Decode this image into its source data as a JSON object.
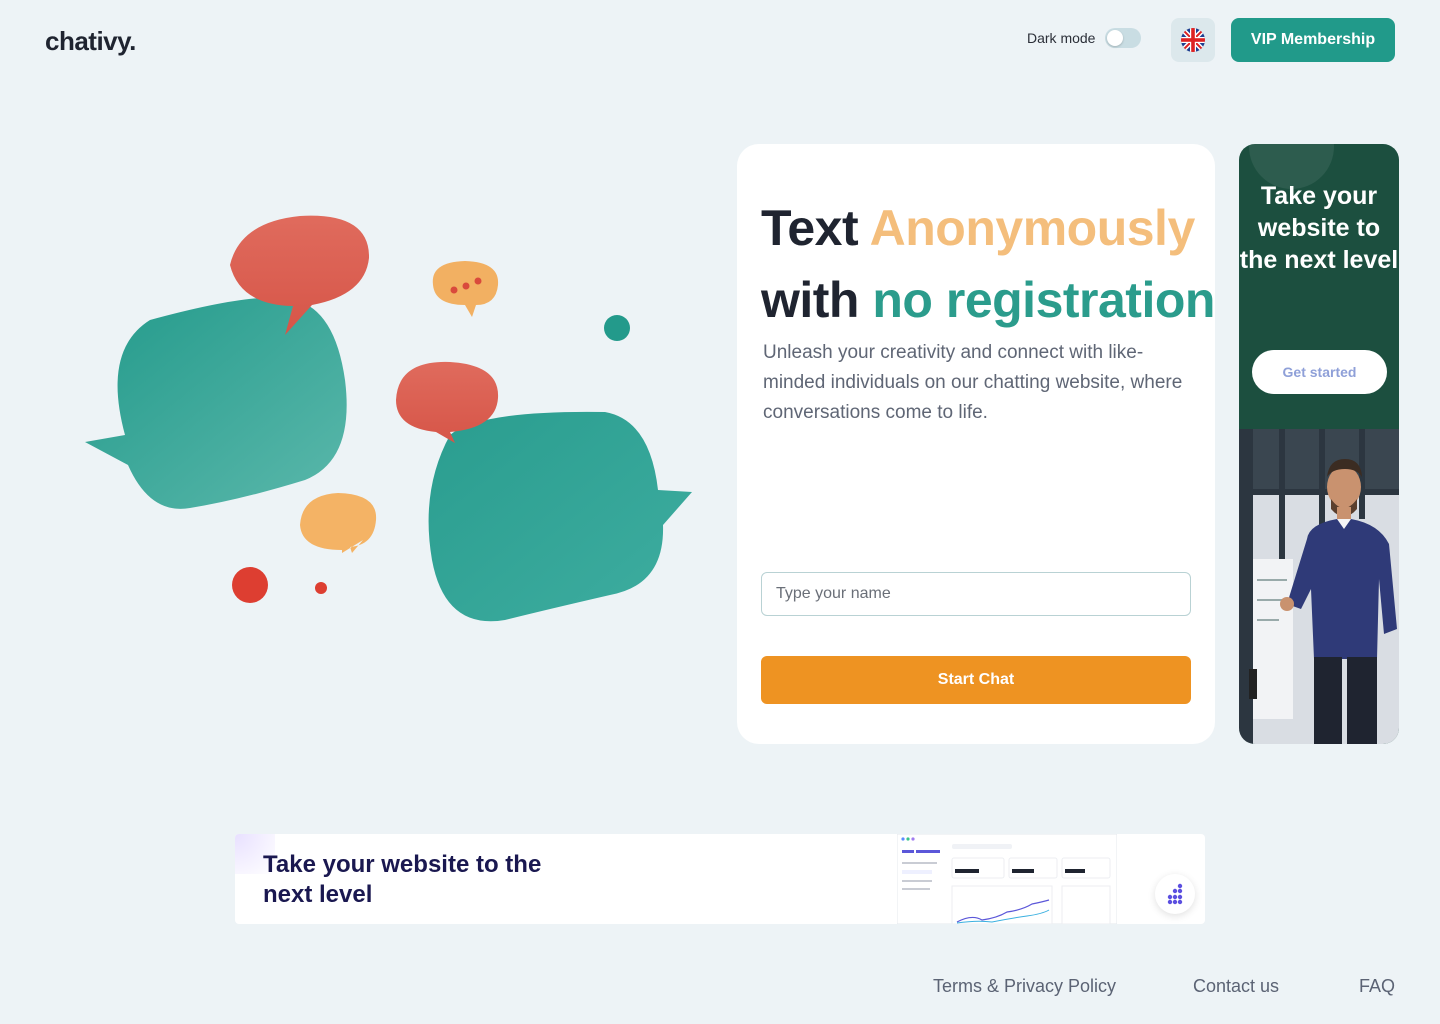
{
  "header": {
    "logo": "chativy.",
    "dark_mode_label": "Dark mode",
    "dark_mode_on": false,
    "language_icon": "uk-flag-icon",
    "vip_label": "VIP Membership"
  },
  "hero": {
    "headline_word1": "Text",
    "headline_word2": "Anonymously",
    "headline_word3": "with",
    "headline_word4": "no registration",
    "subtext": "Unleash your creativity and connect with like-minded individuals on our chatting website, where conversations come to life.",
    "name_placeholder": "Type your name",
    "start_label": "Start Chat"
  },
  "side_ad": {
    "title": "Take your website to the next level",
    "cta": "Get started"
  },
  "banner_ad": {
    "title": "Take your website to the next level"
  },
  "footer": {
    "links": [
      "Terms & Privacy Policy",
      "Contact us",
      "FAQ"
    ]
  },
  "colors": {
    "brand_teal": "#219a8a",
    "accent_orange": "#ee9322",
    "headline_orange": "#f4be7c",
    "bubble_red": "#d9574a",
    "ad_green": "#1c4f3f"
  }
}
